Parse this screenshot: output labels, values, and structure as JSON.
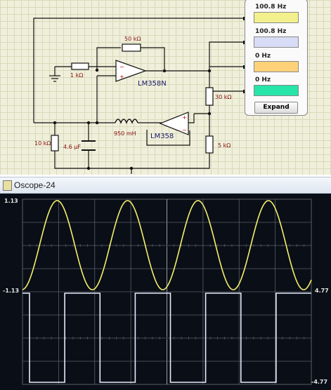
{
  "schematic": {
    "labels": {
      "r_feedback": "50 kΩ",
      "r_input": "1 kΩ",
      "opamp1": "LM358N",
      "inductor": "950 mH",
      "opamp2": "LM358",
      "r_ground": "10 kΩ",
      "capacitor": "4.6 µF",
      "r_div_top": "30 kΩ",
      "r_div_bottom": "5 kΩ"
    }
  },
  "meter": {
    "readings": [
      {
        "value": "100.8 Hz",
        "color": "#f2f08c"
      },
      {
        "value": "100.8 Hz",
        "color": "#d8dcf6"
      },
      {
        "value": "0 Hz",
        "color": "#ffd27a"
      },
      {
        "value": "0 Hz",
        "color": "#27e4a8"
      }
    ],
    "expand_label": "Expand"
  },
  "oscope": {
    "title": "Oscope-24",
    "ch1_top": "1.13",
    "ch1_bottom": "-1.13",
    "ch2_top": "4.77",
    "ch2_bottom": "-4.77",
    "colors": {
      "sine": "#f4ef6c",
      "square": "#e8ebff",
      "grid": "#5a5f66",
      "center": "#9aa0a8"
    },
    "signals": {
      "sine_cycles_visible": 4.1,
      "square_cycles_visible": 4.1
    }
  }
}
